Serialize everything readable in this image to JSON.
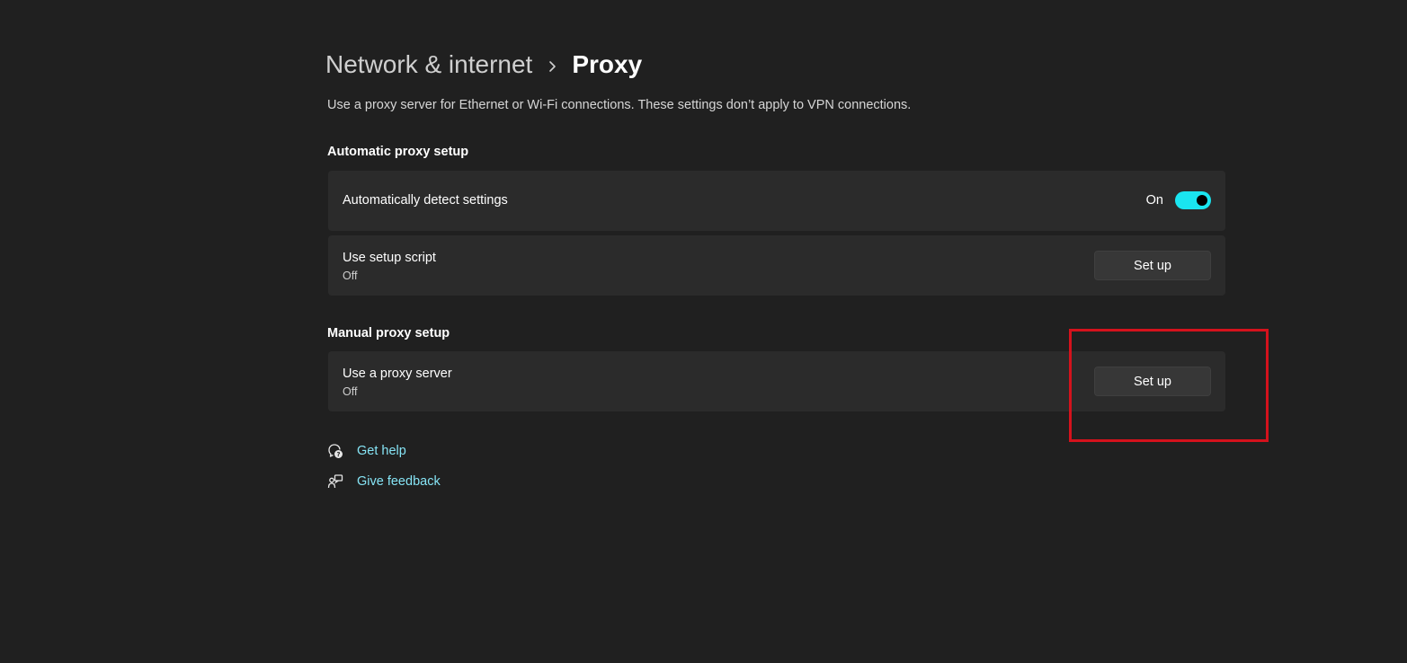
{
  "breadcrumb": {
    "parent": "Network & internet",
    "current": "Proxy"
  },
  "description": "Use a proxy server for Ethernet or Wi-Fi connections. These settings don’t apply to VPN connections.",
  "automatic": {
    "section_title": "Automatic proxy setup",
    "detect": {
      "title": "Automatically detect settings",
      "state_label": "On",
      "enabled": true
    },
    "script": {
      "title": "Use setup script",
      "status": "Off",
      "button_label": "Set up"
    }
  },
  "manual": {
    "section_title": "Manual proxy setup",
    "proxy_server": {
      "title": "Use a proxy server",
      "status": "Off",
      "button_label": "Set up"
    }
  },
  "links": {
    "get_help": "Get help",
    "give_feedback": "Give feedback"
  },
  "colors": {
    "background": "#202020",
    "card": "#2b2b2b",
    "accent": "#1ae5f0",
    "link": "#86e4f5",
    "highlight": "#d4121c"
  },
  "icons": {
    "breadcrumb_separator": "chevron-right-icon",
    "get_help": "help-chat-icon",
    "give_feedback": "feedback-icon"
  }
}
